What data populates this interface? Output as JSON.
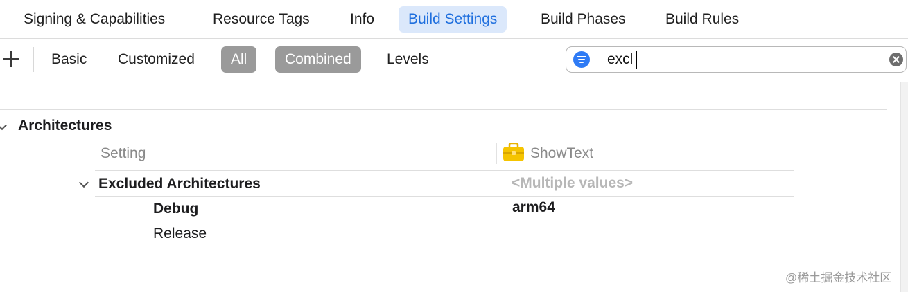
{
  "tabs": [
    {
      "label": "Signing & Capabilities",
      "active": false
    },
    {
      "label": "Resource Tags",
      "active": false
    },
    {
      "label": "Info",
      "active": false
    },
    {
      "label": "Build Settings",
      "active": true
    },
    {
      "label": "Build Phases",
      "active": false
    },
    {
      "label": "Build Rules",
      "active": false
    }
  ],
  "toolbar": {
    "add_icon": "plus-icon",
    "filters": [
      {
        "label": "Basic",
        "selected": false
      },
      {
        "label": "Customized",
        "selected": false
      },
      {
        "label": "All",
        "selected": true
      }
    ],
    "views": [
      {
        "label": "Combined",
        "selected": true
      },
      {
        "label": "Levels",
        "selected": false
      }
    ],
    "search": {
      "value": "excl",
      "filter_icon": "filter-icon",
      "clear_icon": "clear-icon"
    }
  },
  "section": {
    "title": "Architectures",
    "columns": {
      "setting": "Setting",
      "target": "ShowText",
      "target_icon": "toolbox-icon"
    },
    "setting": {
      "name": "Excluded Architectures",
      "value": "<Multiple values>",
      "rows": [
        {
          "name": "Debug",
          "value": "arm64"
        },
        {
          "name": "Release",
          "value": ""
        }
      ]
    }
  },
  "watermark": "@稀土掘金技术社区",
  "colors": {
    "accent": "#1f6fde",
    "active_tab_bg": "#dbe8fb",
    "selected_segment": "#9a9a9a",
    "toolbox": "#f5c400"
  }
}
